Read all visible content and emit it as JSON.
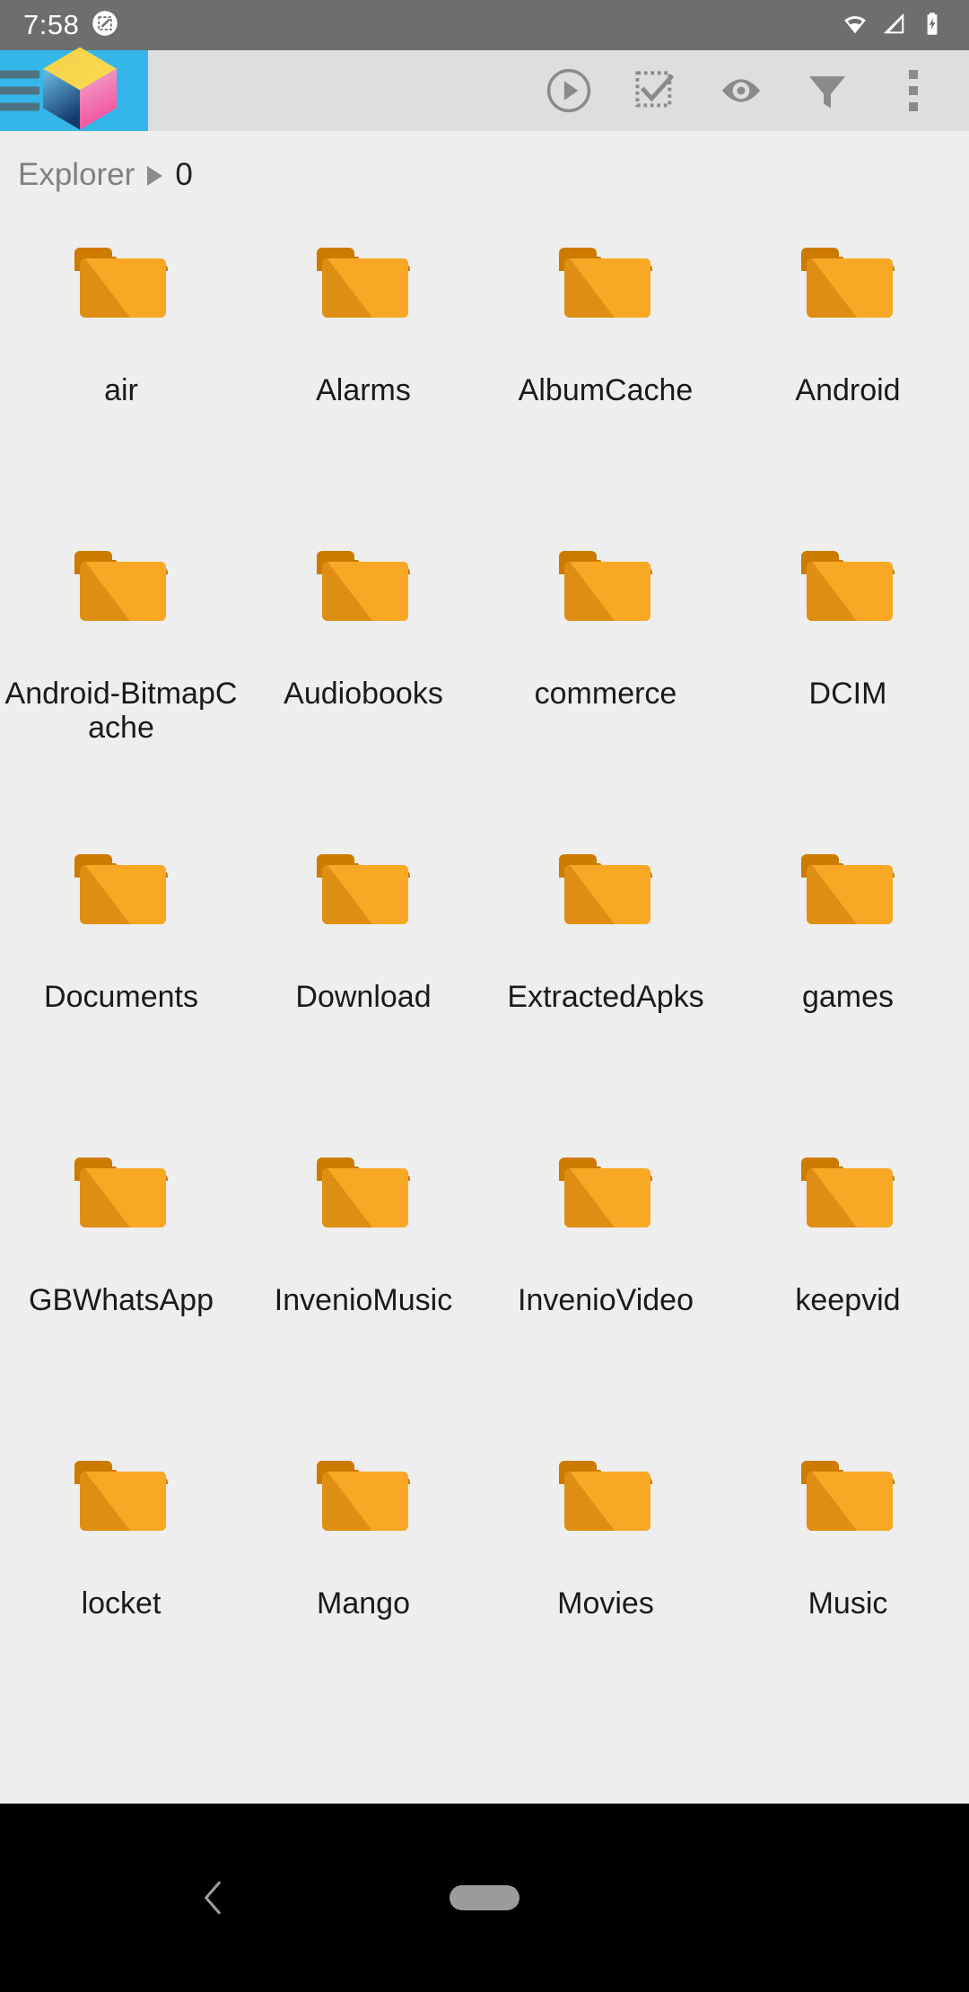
{
  "status_bar": {
    "time": "7:58",
    "notification_icon": "screenshot-edit-icon",
    "right_icons": [
      "wifi-icon",
      "cellular-signal-icon",
      "battery-charging-icon"
    ],
    "background_color": "#6e6e6e"
  },
  "app_bar": {
    "background_color": "#dedede",
    "brand_tile_color": "#35b6e8",
    "menu_icon": "hamburger-menu-icon",
    "app_logo": "cube-logo-icon",
    "actions": [
      {
        "name": "play-circle-icon",
        "label": "Play"
      },
      {
        "name": "select-all-icon",
        "label": "Select all"
      },
      {
        "name": "eye-icon",
        "label": "Show hidden"
      },
      {
        "name": "filter-funnel-icon",
        "label": "Filter"
      },
      {
        "name": "overflow-menu-icon",
        "label": "More options"
      }
    ]
  },
  "breadcrumb": {
    "root": "Explorer",
    "separator": "▶",
    "current": "0"
  },
  "grid": {
    "columns": 4,
    "items": [
      {
        "name": "air",
        "type": "folder"
      },
      {
        "name": "Alarms",
        "type": "folder"
      },
      {
        "name": "AlbumCache",
        "type": "folder"
      },
      {
        "name": "Android",
        "type": "folder"
      },
      {
        "name": "Android-BitmapCache",
        "type": "folder"
      },
      {
        "name": "Audiobooks",
        "type": "folder"
      },
      {
        "name": "commerce",
        "type": "folder"
      },
      {
        "name": "DCIM",
        "type": "folder"
      },
      {
        "name": "Documents",
        "type": "folder"
      },
      {
        "name": "Download",
        "type": "folder"
      },
      {
        "name": "ExtractedApks",
        "type": "folder"
      },
      {
        "name": "games",
        "type": "folder"
      },
      {
        "name": "GBWhatsApp",
        "type": "folder"
      },
      {
        "name": "InvenioMusic",
        "type": "folder"
      },
      {
        "name": "InvenioVideo",
        "type": "folder"
      },
      {
        "name": "keepvid",
        "type": "folder"
      },
      {
        "name": "locket",
        "type": "folder"
      },
      {
        "name": "Mango",
        "type": "folder"
      },
      {
        "name": "Movies",
        "type": "folder"
      },
      {
        "name": "Music",
        "type": "folder"
      }
    ],
    "folder_colors": {
      "back": "#cc7a00",
      "front_light": "#f9a826",
      "front_dark": "#de8e12"
    },
    "background_color": "#eeeeee"
  },
  "nav_bar": {
    "background_color": "#000000",
    "back_icon": "back-chevron-icon",
    "home_icon": "home-pill-icon"
  }
}
